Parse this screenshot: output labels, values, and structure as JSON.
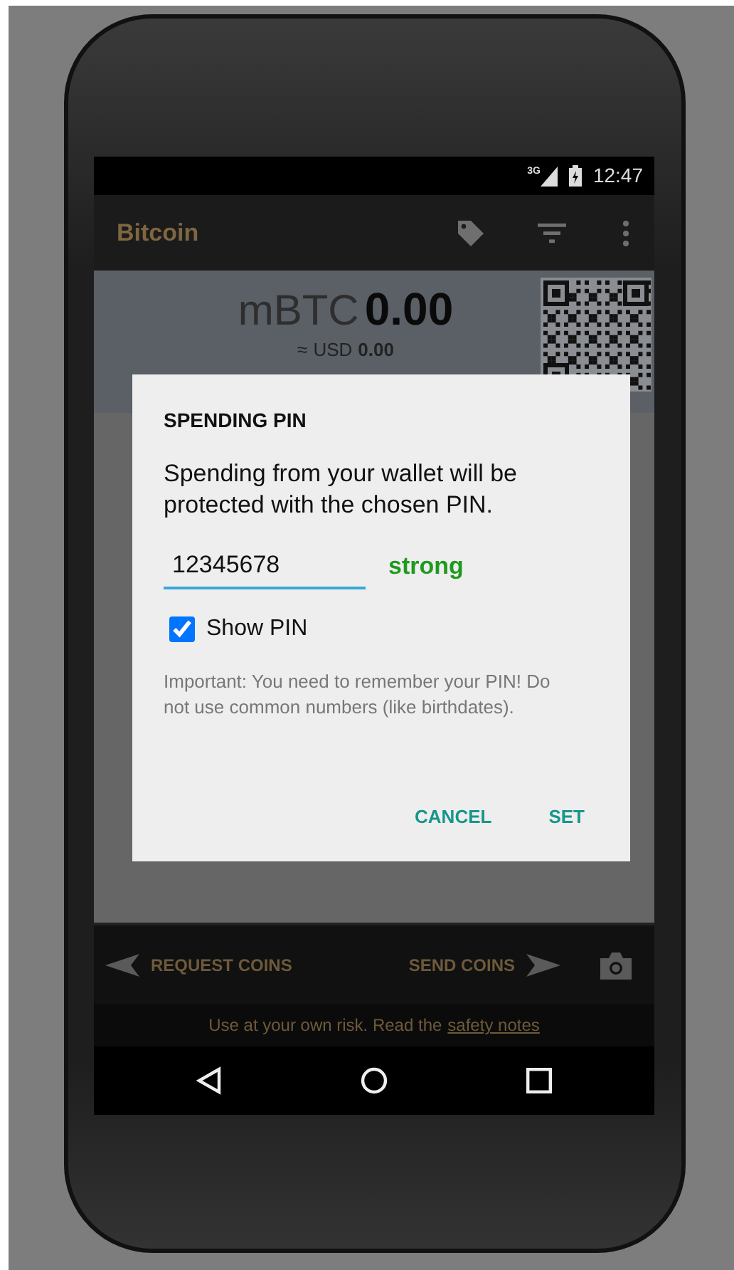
{
  "status_bar": {
    "network": "3G",
    "time": "12:47"
  },
  "app_bar": {
    "title": "Bitcoin"
  },
  "balance": {
    "unit": "mBTC",
    "amount": "0.00",
    "fiat_prefix": "≈",
    "fiat_unit": "USD",
    "fiat_amount": "0.00"
  },
  "dialog": {
    "title": "SPENDING PIN",
    "message": "Spending from your wallet will be protected with the chosen PIN.",
    "pin_value": "12345678",
    "strength": "strong",
    "show_pin": {
      "label": "Show PIN",
      "checked": true
    },
    "note": "Important: You need to remember your PIN! Do not use common numbers (like birthdates).",
    "buttons": [
      {
        "label": "CANCEL"
      },
      {
        "label": "SET"
      }
    ]
  },
  "action_bar": {
    "request": "REQUEST COINS",
    "send": "SEND COINS"
  },
  "footer": {
    "text": "Use at your own risk. Read the",
    "link": "safety notes"
  }
}
